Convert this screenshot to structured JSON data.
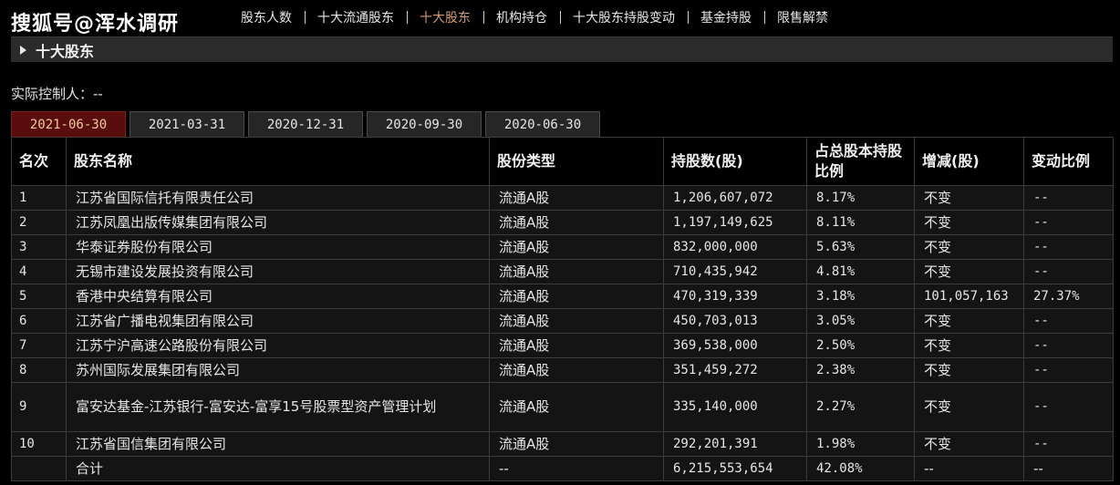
{
  "brand": "搜狐号@浑水调研",
  "nav": [
    {
      "label": "股东人数",
      "active": false
    },
    {
      "label": "十大流通股东",
      "active": false
    },
    {
      "label": "十大股东",
      "active": true
    },
    {
      "label": "机构持仓",
      "active": false
    },
    {
      "label": "十大股东持股变动",
      "active": false
    },
    {
      "label": "基金持股",
      "active": false
    },
    {
      "label": "限售解禁",
      "active": false
    }
  ],
  "section_title": "十大股东",
  "controller": "实际控制人：--",
  "date_tabs": [
    {
      "label": "2021-06-30",
      "active": true
    },
    {
      "label": "2021-03-31",
      "active": false
    },
    {
      "label": "2020-12-31",
      "active": false
    },
    {
      "label": "2020-09-30",
      "active": false
    },
    {
      "label": "2020-06-30",
      "active": false
    }
  ],
  "table": {
    "headers": [
      "名次",
      "股东名称",
      "股份类型",
      "持股数(股)",
      "占总股本持股比例",
      "增减(股)",
      "变动比例"
    ],
    "rows": [
      [
        "1",
        "江苏省国际信托有限责任公司",
        "流通A股",
        "1,206,607,072",
        "8.17%",
        "不变",
        "--"
      ],
      [
        "2",
        "江苏凤凰出版传媒集团有限公司",
        "流通A股",
        "1,197,149,625",
        "8.11%",
        "不变",
        "--"
      ],
      [
        "3",
        "华泰证券股份有限公司",
        "流通A股",
        "832,000,000",
        "5.63%",
        "不变",
        "--"
      ],
      [
        "4",
        "无锡市建设发展投资有限公司",
        "流通A股",
        "710,435,942",
        "4.81%",
        "不变",
        "--"
      ],
      [
        "5",
        "香港中央结算有限公司",
        "流通A股",
        "470,319,339",
        "3.18%",
        "101,057,163",
        "27.37%"
      ],
      [
        "6",
        "江苏省广播电视集团有限公司",
        "流通A股",
        "450,703,013",
        "3.05%",
        "不变",
        "--"
      ],
      [
        "7",
        "江苏宁沪高速公路股份有限公司",
        "流通A股",
        "369,538,000",
        "2.50%",
        "不变",
        "--"
      ],
      [
        "8",
        "苏州国际发展集团有限公司",
        "流通A股",
        "351,459,272",
        "2.38%",
        "不变",
        "--"
      ],
      [
        "9",
        "富安达基金-江苏银行-富安达-富享15号股票型资产管理计划",
        "流通A股",
        "335,140,000",
        "2.27%",
        "不变",
        "--"
      ],
      [
        "10",
        "江苏省国信集团有限公司",
        "流通A股",
        "292,201,391",
        "1.98%",
        "不变",
        "--"
      ]
    ],
    "total": [
      "",
      "合计",
      "--",
      "6,215,553,654",
      "42.08%",
      "--",
      "--"
    ]
  }
}
